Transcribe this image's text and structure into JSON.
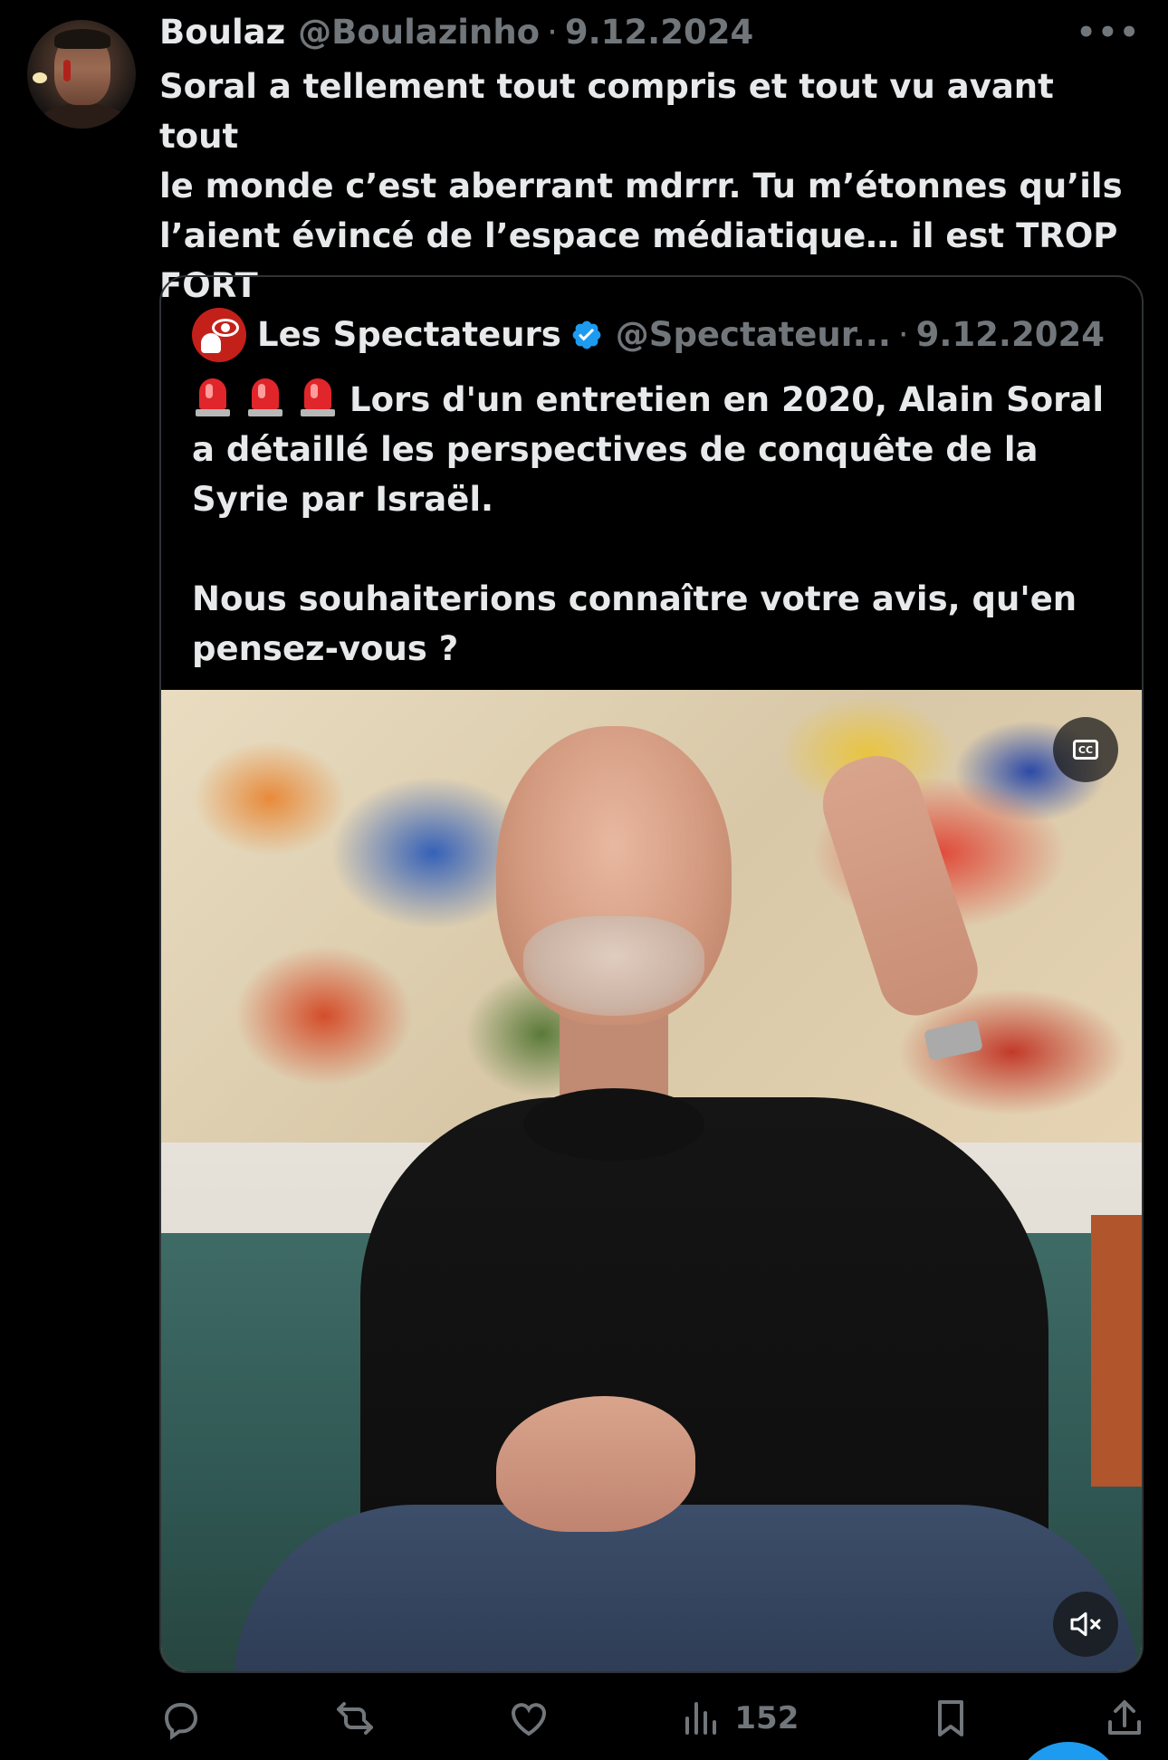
{
  "post": {
    "author_name": "Boulaz",
    "author_handle": "@Boulazinho",
    "separator": "·",
    "date": "9.12.2024",
    "more_label": "•••",
    "text": "Soral a tellement tout compris et tout vu avant tout\nle monde c’est aberrant mdrrr. Tu m’étonnes qu’ils\nl’aient évincé de l’espace médiatique… il est TROP\nFORT"
  },
  "quoted": {
    "author_name": "Les Spectateurs",
    "author_handle": "@Spectateur...",
    "separator": "·",
    "date": "9.12.2024",
    "text_line1": "Lors d'un entretien en 2020, Alain Soral",
    "text_rest": "a détaillé les perspectives de conquête de la\nSyrie par Israël.\n\nNous souhaiterions connaître votre avis, qu'en\npensez-vous ?",
    "video": {
      "cc_label": "CC",
      "cc_icon": "closed-captions-icon",
      "mute_icon": "muted-speaker-icon"
    }
  },
  "actions": {
    "views_count": "152",
    "icons": [
      "reply-icon",
      "repost-icon",
      "like-icon",
      "views-icon",
      "bookmark-icon",
      "share-icon"
    ]
  },
  "colors": {
    "background": "#000000",
    "text_primary": "#e7e9ea",
    "text_secondary": "#71767b",
    "border": "#2f3336",
    "verified_blue": "#1d9bf0"
  }
}
